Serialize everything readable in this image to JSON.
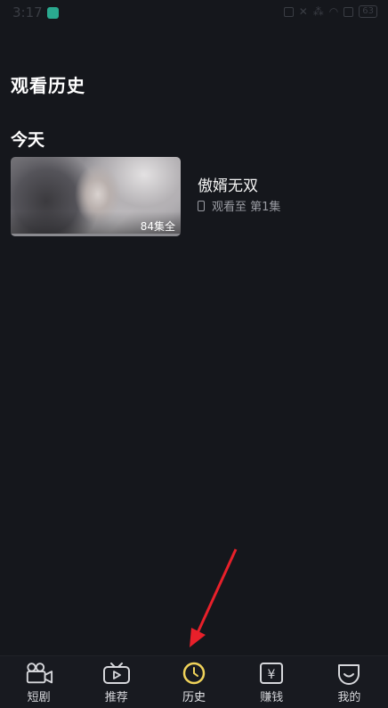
{
  "status_bar": {
    "time": "3:17",
    "battery": "63"
  },
  "page": {
    "title": "观看历史"
  },
  "section": {
    "label": "今天"
  },
  "history": [
    {
      "title": "傲婿无双",
      "episode_badge": "84集全",
      "progress_text": "观看至 第1集"
    }
  ],
  "nav": {
    "items": [
      {
        "label": "短剧",
        "icon": "camera-icon",
        "active": false
      },
      {
        "label": "推荐",
        "icon": "tv-icon",
        "active": false
      },
      {
        "label": "历史",
        "icon": "clock-icon",
        "active": true
      },
      {
        "label": "赚钱",
        "icon": "yen-icon",
        "active": false
      },
      {
        "label": "我的",
        "icon": "face-icon",
        "active": false
      }
    ]
  },
  "colors": {
    "background": "#15171c",
    "active_icon": "#f0d35a",
    "arrow": "#e8202a"
  }
}
